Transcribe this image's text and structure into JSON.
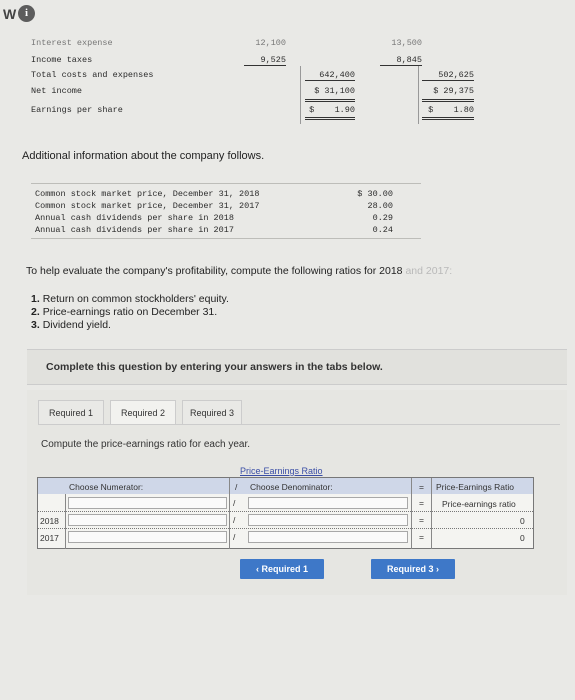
{
  "header": {
    "logo_text": "W",
    "info_icon": "i"
  },
  "income_statement": {
    "rows": [
      {
        "label": "Interest expense",
        "col_2018": "12,100",
        "col_2017": "13,500"
      },
      {
        "label": "Income taxes",
        "col_2018": "9,525",
        "col_2017": "8,845"
      },
      {
        "label": "Total costs and expenses",
        "total_2018": "642,400",
        "total_2017": "502,625"
      },
      {
        "label": "Net income",
        "total_2018": "$ 31,100",
        "total_2017": "$ 29,375"
      },
      {
        "label": "Earnings per share",
        "total_2018": "$    1.90",
        "total_2017": "$    1.80"
      }
    ]
  },
  "additional_info": {
    "title": "Additional information about the company follows.",
    "rows": [
      {
        "label": "Common stock market price, December 31, 2018",
        "value": "$ 30.00"
      },
      {
        "label": "Common stock market price, December 31, 2017",
        "value": "28.00"
      },
      {
        "label": "Annual cash dividends per share in 2018",
        "value": "0.29"
      },
      {
        "label": "Annual cash dividends per share in 2017",
        "value": "0.24"
      }
    ]
  },
  "question": {
    "intro": "To help evaluate the company's profitability, compute the following ratios for 2018",
    "intro_tail": " and 2017:",
    "items": [
      {
        "num": "1.",
        "text": "Return on common stockholders' equity."
      },
      {
        "num": "2.",
        "text": "Price-earnings ratio on December 31."
      },
      {
        "num": "3.",
        "text": "Dividend yield."
      }
    ]
  },
  "complete_bar": {
    "text": "Complete this question by entering your answers in the tabs below."
  },
  "tabs": [
    {
      "label": "Required 1",
      "active": false
    },
    {
      "label": "Required 2",
      "active": true
    },
    {
      "label": "Required 3",
      "active": false
    }
  ],
  "compute_text": "Compute the price-earnings ratio for each year.",
  "grid": {
    "title": "Price-Earnings Ratio",
    "numerator_header": "Choose Numerator:",
    "slash": "/",
    "denominator_header": "Choose Denominator:",
    "equals": "=",
    "result_header": "Price-Earnings Ratio",
    "result_subheader": "Price-earnings ratio",
    "rows": [
      {
        "year": "2018",
        "numerator": "",
        "denominator": "",
        "result": "0"
      },
      {
        "year": "2017",
        "numerator": "",
        "denominator": "",
        "result": "0"
      }
    ]
  },
  "nav": {
    "prev_label": "Required 1",
    "next_label": "Required 3",
    "prev_icon": "‹",
    "next_icon": "›"
  },
  "colors": {
    "accent": "#3e78c8",
    "header_bg": "#cfd7e8"
  }
}
